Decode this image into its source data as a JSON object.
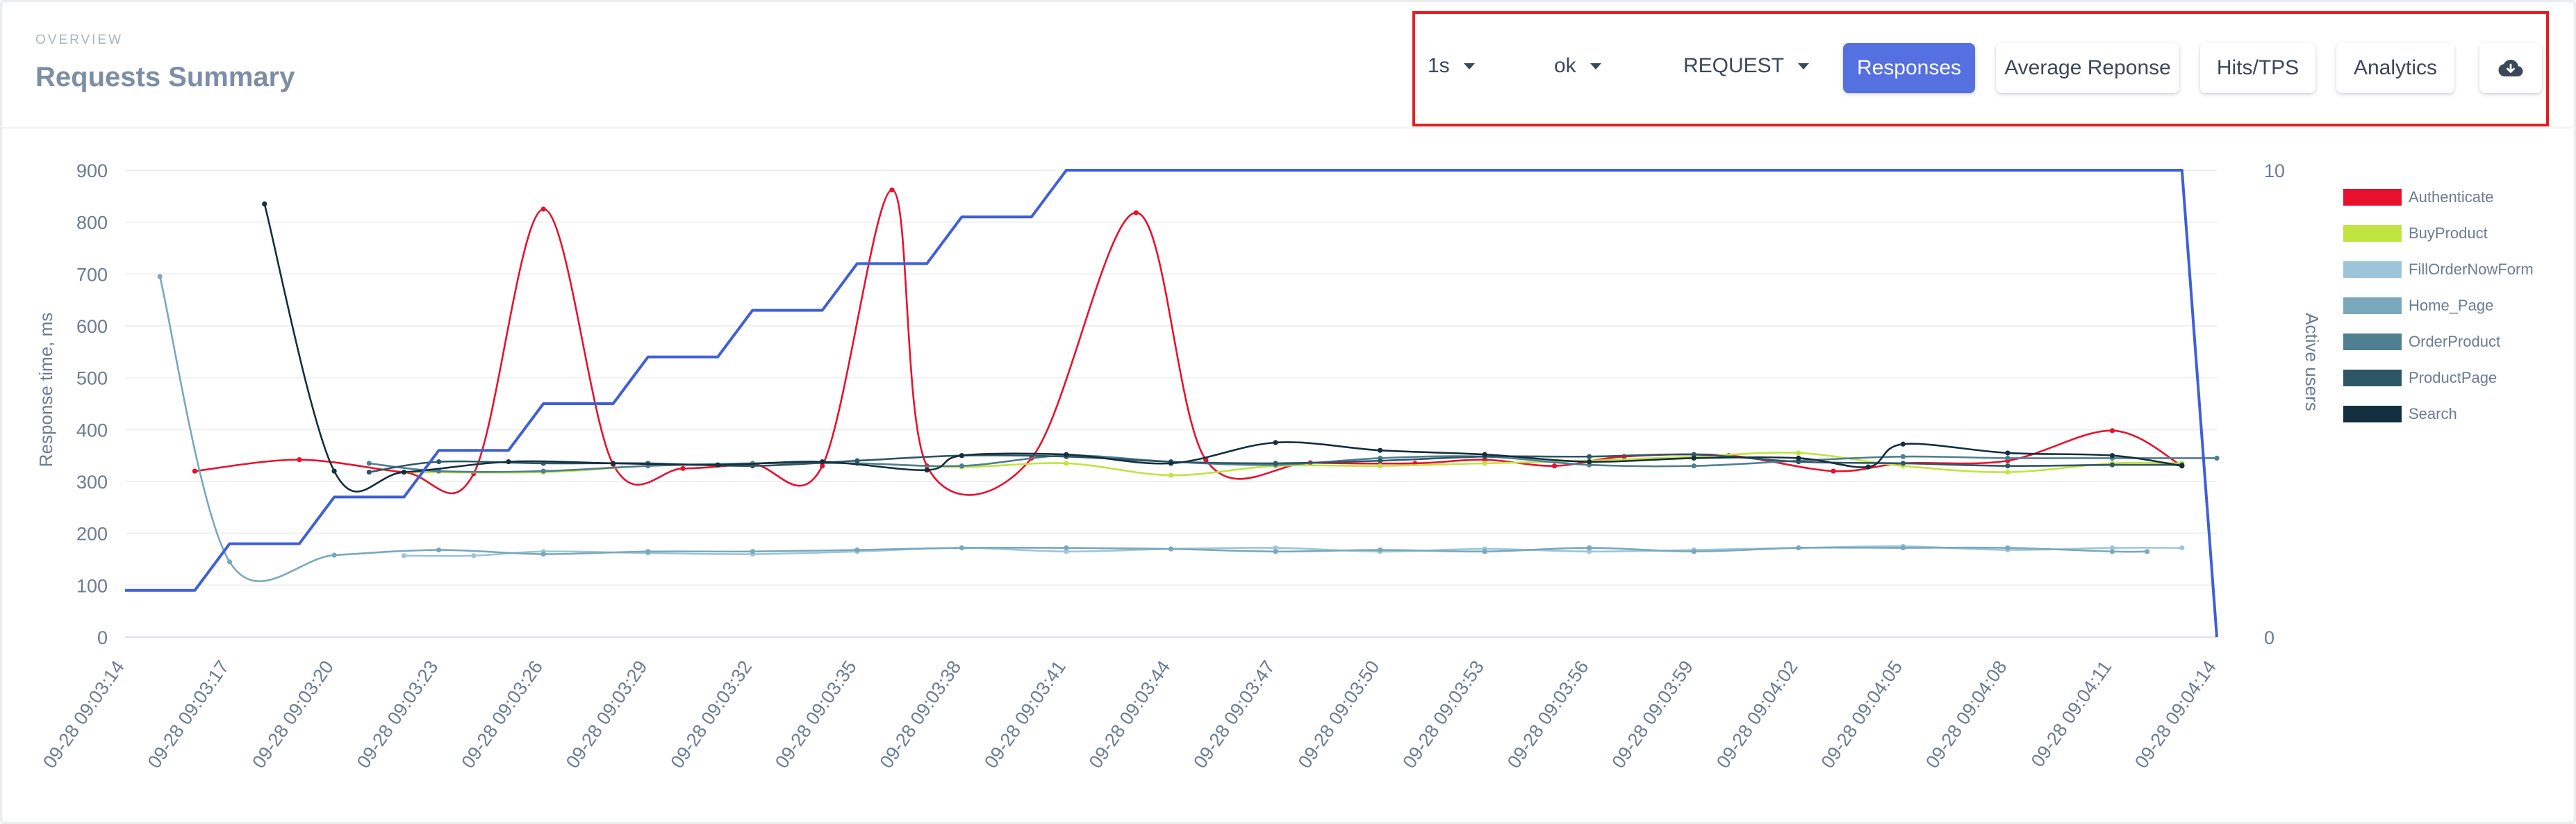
{
  "header": {
    "overview_label": "OVERVIEW",
    "title": "Requests Summary"
  },
  "toolbar": {
    "interval_value": "1s",
    "status_value": "ok",
    "type_value": "REQUEST",
    "buttons": [
      "Responses",
      "Average Reponse",
      "Hits/TPS",
      "Analytics"
    ],
    "active_button": "Responses",
    "download_icon": "cloud-download-icon"
  },
  "colors": {
    "accent": "#5570e0",
    "highlight_box": "#e02020"
  },
  "chart_data": {
    "type": "line",
    "ylabel": "Response time, ms",
    "y2label": "Active users",
    "ylim": [
      0,
      900
    ],
    "y2lim": [
      0,
      10
    ],
    "y_ticks": [
      0,
      100,
      200,
      300,
      400,
      500,
      600,
      700,
      800,
      900
    ],
    "y2_ticks": [
      0,
      10
    ],
    "x_start": "09-28 09:03:14",
    "x_end": "09-28 09:04:14",
    "x_tick_labels": [
      "09-28 09:03:14",
      "09-28 09:03:17",
      "09-28 09:03:20",
      "09-28 09:03:23",
      "09-28 09:03:26",
      "09-28 09:03:29",
      "09-28 09:03:32",
      "09-28 09:03:35",
      "09-28 09:03:38",
      "09-28 09:03:41",
      "09-28 09:03:44",
      "09-28 09:03:47",
      "09-28 09:03:50",
      "09-28 09:03:53",
      "09-28 09:03:56",
      "09-28 09:03:59",
      "09-28 09:04:02",
      "09-28 09:04:05",
      "09-28 09:04:08",
      "09-28 09:04:11",
      "09-28 09:04:14"
    ],
    "grid": "horizontal",
    "legend_position": "right",
    "series": [
      {
        "name": "Authenticate",
        "color": "#e8112d",
        "points": [
          [
            "09-28 09:03:16",
            320
          ],
          [
            "09-28 09:03:19",
            342
          ],
          [
            "09-28 09:03:22",
            318
          ],
          [
            "09-28 09:03:24",
            315
          ],
          [
            "09-28 09:03:26",
            825
          ],
          [
            "09-28 09:03:28",
            333
          ],
          [
            "09-28 09:03:30",
            325
          ],
          [
            "09-28 09:03:32",
            333
          ],
          [
            "09-28 09:03:34",
            330
          ],
          [
            "09-28 09:03:36",
            862
          ],
          [
            "09-28 09:03:37",
            330
          ],
          [
            "09-28 09:03:40",
            345
          ],
          [
            "09-28 09:03:43",
            818
          ],
          [
            "09-28 09:03:45",
            342
          ],
          [
            "09-28 09:03:48",
            336
          ],
          [
            "09-28 09:03:51",
            335
          ],
          [
            "09-28 09:03:53",
            342
          ],
          [
            "09-28 09:03:55",
            330
          ],
          [
            "09-28 09:03:57",
            348
          ],
          [
            "09-28 09:04:00",
            350
          ],
          [
            "09-28 09:04:03",
            320
          ],
          [
            "09-28 09:04:05",
            335
          ],
          [
            "09-28 09:04:08",
            340
          ],
          [
            "09-28 09:04:11",
            398
          ],
          [
            "09-28 09:04:13",
            330
          ]
        ]
      },
      {
        "name": "BuyProduct",
        "color": "#c0e440",
        "points": [
          [
            "09-28 09:03:22",
            318
          ],
          [
            "09-28 09:03:26",
            318
          ],
          [
            "09-28 09:03:29",
            330
          ],
          [
            "09-28 09:03:32",
            335
          ],
          [
            "09-28 09:03:35",
            335
          ],
          [
            "09-28 09:03:38",
            328
          ],
          [
            "09-28 09:03:41",
            335
          ],
          [
            "09-28 09:03:44",
            312
          ],
          [
            "09-28 09:03:47",
            330
          ],
          [
            "09-28 09:03:50",
            330
          ],
          [
            "09-28 09:03:53",
            335
          ],
          [
            "09-28 09:03:56",
            340
          ],
          [
            "09-28 09:03:59",
            348
          ],
          [
            "09-28 09:04:02",
            355
          ],
          [
            "09-28 09:04:05",
            330
          ],
          [
            "09-28 09:04:08",
            318
          ],
          [
            "09-28 09:04:11",
            335
          ],
          [
            "09-28 09:04:13",
            335
          ]
        ]
      },
      {
        "name": "FillOrderNowForm",
        "color": "#9dc5d9",
        "points": [
          [
            "09-28 09:03:22",
            157
          ],
          [
            "09-28 09:03:24",
            157
          ],
          [
            "09-28 09:03:26",
            165
          ],
          [
            "09-28 09:03:29",
            162
          ],
          [
            "09-28 09:03:32",
            160
          ],
          [
            "09-28 09:03:35",
            165
          ],
          [
            "09-28 09:03:38",
            172
          ],
          [
            "09-28 09:03:41",
            165
          ],
          [
            "09-28 09:03:44",
            170
          ],
          [
            "09-28 09:03:47",
            172
          ],
          [
            "09-28 09:03:50",
            165
          ],
          [
            "09-28 09:03:53",
            170
          ],
          [
            "09-28 09:03:56",
            165
          ],
          [
            "09-28 09:03:59",
            168
          ],
          [
            "09-28 09:04:02",
            172
          ],
          [
            "09-28 09:04:05",
            175
          ],
          [
            "09-28 09:04:08",
            168
          ],
          [
            "09-28 09:04:11",
            172
          ],
          [
            "09-28 09:04:13",
            172
          ]
        ]
      },
      {
        "name": "Home_Page",
        "color": "#79a8bd",
        "points": [
          [
            "09-28 09:03:15",
            695
          ],
          [
            "09-28 09:03:17",
            145
          ],
          [
            "09-28 09:03:20",
            158
          ],
          [
            "09-28 09:03:23",
            168
          ],
          [
            "09-28 09:03:26",
            160
          ],
          [
            "09-28 09:03:29",
            165
          ],
          [
            "09-28 09:03:32",
            165
          ],
          [
            "09-28 09:03:35",
            168
          ],
          [
            "09-28 09:03:38",
            172
          ],
          [
            "09-28 09:03:41",
            172
          ],
          [
            "09-28 09:03:44",
            170
          ],
          [
            "09-28 09:03:47",
            165
          ],
          [
            "09-28 09:03:50",
            168
          ],
          [
            "09-28 09:03:53",
            165
          ],
          [
            "09-28 09:03:56",
            172
          ],
          [
            "09-28 09:03:59",
            165
          ],
          [
            "09-28 09:04:02",
            172
          ],
          [
            "09-28 09:04:05",
            172
          ],
          [
            "09-28 09:04:08",
            172
          ],
          [
            "09-28 09:04:11",
            165
          ],
          [
            "09-28 09:04:12",
            165
          ]
        ]
      },
      {
        "name": "OrderProduct",
        "color": "#4f7f91",
        "points": [
          [
            "09-28 09:03:21",
            335
          ],
          [
            "09-28 09:03:23",
            320
          ],
          [
            "09-28 09:03:26",
            320
          ],
          [
            "09-28 09:03:29",
            330
          ],
          [
            "09-28 09:03:32",
            335
          ],
          [
            "09-28 09:03:35",
            335
          ],
          [
            "09-28 09:03:38",
            330
          ],
          [
            "09-28 09:03:41",
            350
          ],
          [
            "09-28 09:03:44",
            338
          ],
          [
            "09-28 09:03:47",
            332
          ],
          [
            "09-28 09:03:50",
            345
          ],
          [
            "09-28 09:03:53",
            348
          ],
          [
            "09-28 09:03:56",
            332
          ],
          [
            "09-28 09:03:59",
            330
          ],
          [
            "09-28 09:04:02",
            340
          ],
          [
            "09-28 09:04:05",
            348
          ],
          [
            "09-28 09:04:08",
            345
          ],
          [
            "09-28 09:04:11",
            345
          ],
          [
            "09-28 09:04:14",
            345
          ]
        ]
      },
      {
        "name": "ProductPage",
        "color": "#2e5766",
        "points": [
          [
            "09-28 09:03:21",
            318
          ],
          [
            "09-28 09:03:23",
            338
          ],
          [
            "09-28 09:03:26",
            335
          ],
          [
            "09-28 09:03:29",
            335
          ],
          [
            "09-28 09:03:32",
            330
          ],
          [
            "09-28 09:03:35",
            340
          ],
          [
            "09-28 09:03:38",
            350
          ],
          [
            "09-28 09:03:41",
            348
          ],
          [
            "09-28 09:03:44",
            338
          ],
          [
            "09-28 09:03:47",
            335
          ],
          [
            "09-28 09:03:50",
            340
          ],
          [
            "09-28 09:03:53",
            348
          ],
          [
            "09-28 09:03:56",
            348
          ],
          [
            "09-28 09:03:59",
            352
          ],
          [
            "09-28 09:04:02",
            338
          ],
          [
            "09-28 09:04:05",
            335
          ],
          [
            "09-28 09:04:08",
            330
          ],
          [
            "09-28 09:04:11",
            332
          ],
          [
            "09-28 09:04:13",
            332
          ]
        ]
      },
      {
        "name": "Search",
        "color": "#142f3f",
        "points": [
          [
            "09-28 09:03:18",
            835
          ],
          [
            "09-28 09:03:20",
            320
          ],
          [
            "09-28 09:03:22",
            318
          ],
          [
            "09-28 09:03:25",
            338
          ],
          [
            "09-28 09:03:28",
            335
          ],
          [
            "09-28 09:03:31",
            332
          ],
          [
            "09-28 09:03:34",
            338
          ],
          [
            "09-28 09:03:37",
            322
          ],
          [
            "09-28 09:03:38",
            350
          ],
          [
            "09-28 09:03:41",
            352
          ],
          [
            "09-28 09:03:44",
            335
          ],
          [
            "09-28 09:03:47",
            375
          ],
          [
            "09-28 09:03:50",
            360
          ],
          [
            "09-28 09:03:53",
            352
          ],
          [
            "09-28 09:03:56",
            338
          ],
          [
            "09-28 09:03:59",
            345
          ],
          [
            "09-28 09:04:02",
            345
          ],
          [
            "09-28 09:04:04",
            328
          ],
          [
            "09-28 09:04:05",
            372
          ],
          [
            "09-28 09:04:08",
            355
          ],
          [
            "09-28 09:04:11",
            350
          ],
          [
            "09-28 09:04:13",
            330
          ]
        ]
      }
    ],
    "active_users": {
      "name": "Active users",
      "color": "#3f5fd8",
      "points": [
        [
          "09-28 09:03:14",
          1
        ],
        [
          "09-28 09:03:16",
          1
        ],
        [
          "09-28 09:03:17",
          2
        ],
        [
          "09-28 09:03:19",
          2
        ],
        [
          "09-28 09:03:20",
          3
        ],
        [
          "09-28 09:03:22",
          3
        ],
        [
          "09-28 09:03:23",
          4
        ],
        [
          "09-28 09:03:25",
          4
        ],
        [
          "09-28 09:03:26",
          5
        ],
        [
          "09-28 09:03:28",
          5
        ],
        [
          "09-28 09:03:29",
          6
        ],
        [
          "09-28 09:03:31",
          6
        ],
        [
          "09-28 09:03:32",
          7
        ],
        [
          "09-28 09:03:34",
          7
        ],
        [
          "09-28 09:03:35",
          8
        ],
        [
          "09-28 09:03:37",
          8
        ],
        [
          "09-28 09:03:38",
          9
        ],
        [
          "09-28 09:03:40",
          9
        ],
        [
          "09-28 09:03:41",
          10
        ],
        [
          "09-28 09:04:13",
          10
        ],
        [
          "09-28 09:04:14",
          0
        ]
      ]
    }
  }
}
